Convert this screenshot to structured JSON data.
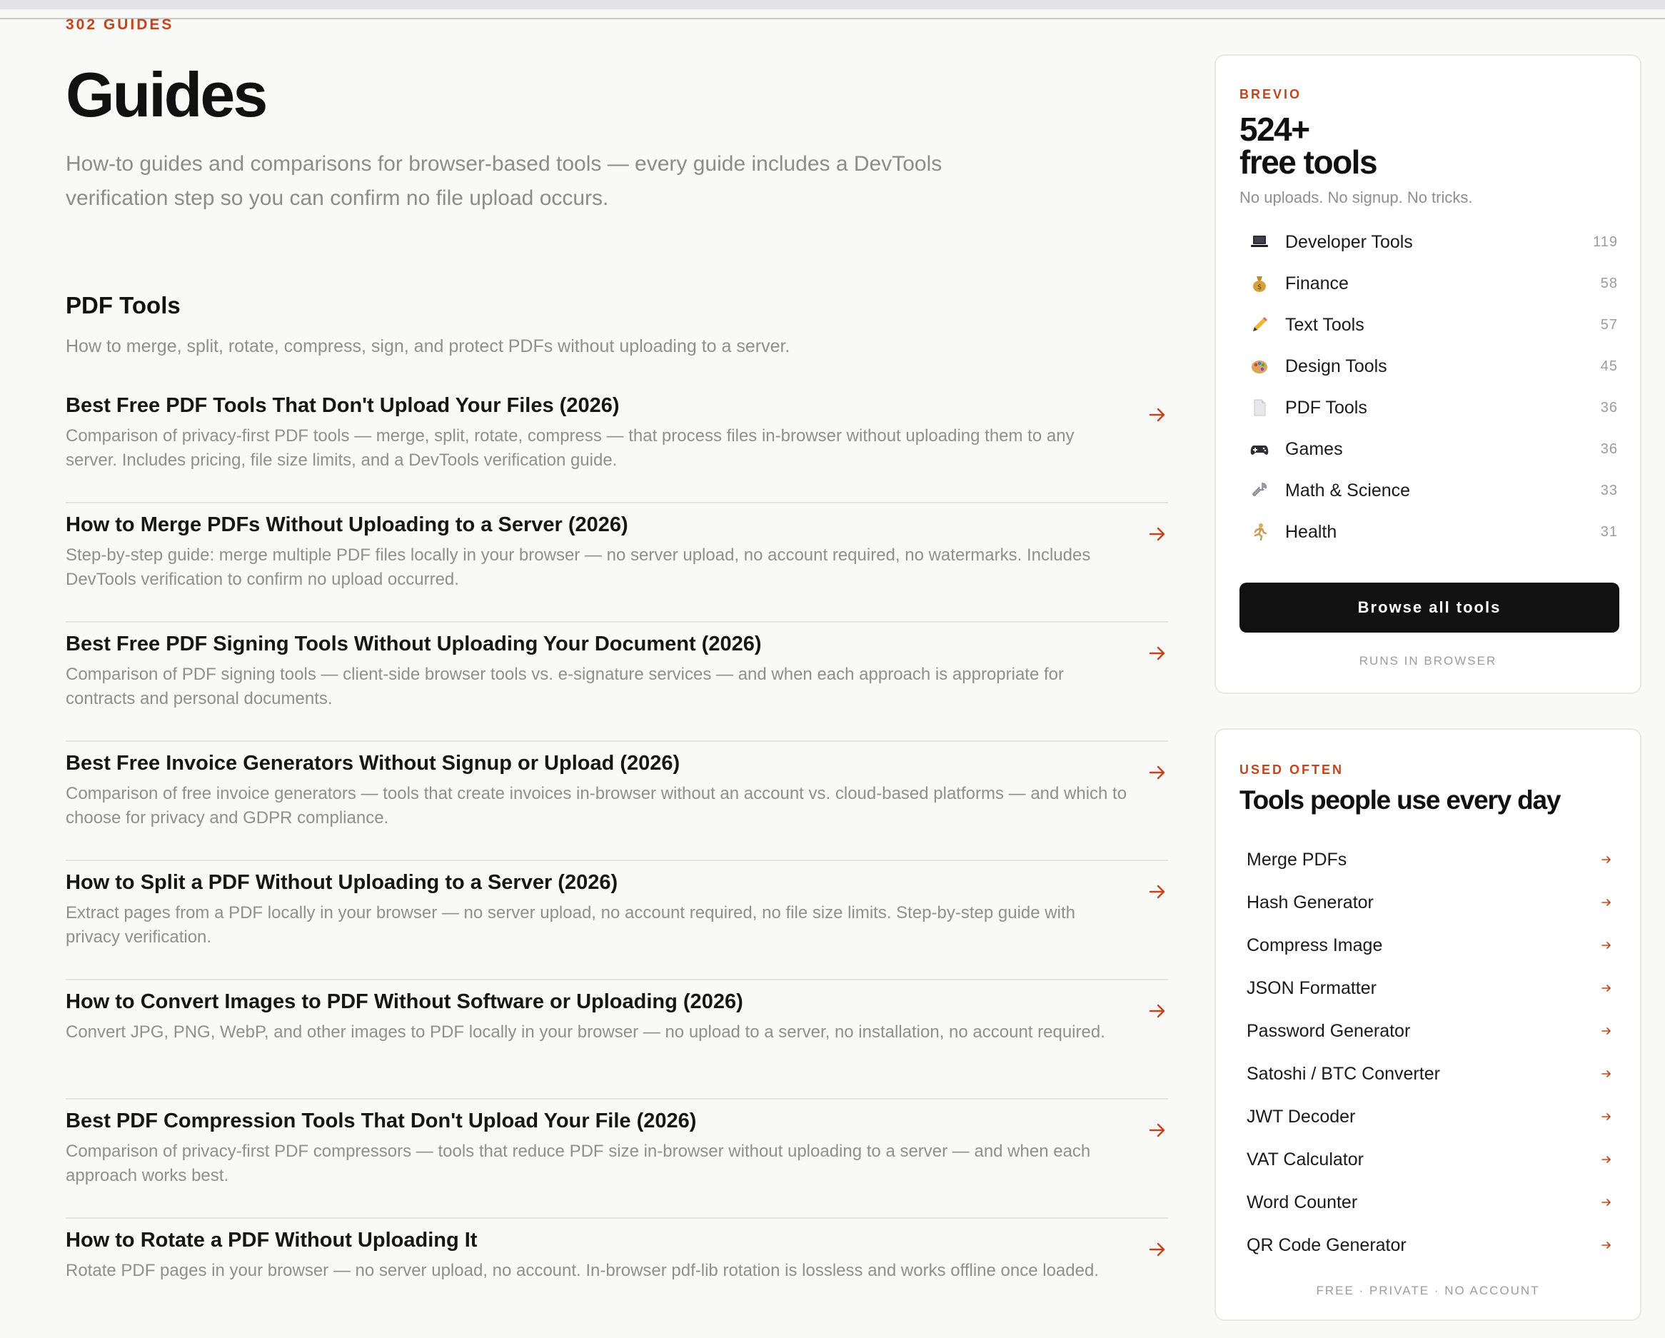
{
  "page": {
    "kicker": "302 GUIDES",
    "title": "Guides",
    "subtitle": "How-to guides and comparisons for browser-based tools — every guide includes a DevTools verification step so you can confirm no file upload occurs."
  },
  "section": {
    "title": "PDF Tools",
    "description": "How to merge, split, rotate, compress, sign, and protect PDFs without uploading to a server."
  },
  "guides": [
    {
      "title": "Best Free PDF Tools That Don't Upload Your Files (2026)",
      "description": "Comparison of privacy-first PDF tools — merge, split, rotate, compress — that process files in-browser without uploading them to any server. Includes pricing, file size limits, and a DevTools verification guide."
    },
    {
      "title": "How to Merge PDFs Without Uploading to a Server (2026)",
      "description": "Step-by-step guide: merge multiple PDF files locally in your browser — no server upload, no account required, no watermarks. Includes DevTools verification to confirm no upload occurred."
    },
    {
      "title": "Best Free PDF Signing Tools Without Uploading Your Document (2026)",
      "description": "Comparison of PDF signing tools — client-side browser tools vs. e-signature services — and when each approach is appropriate for contracts and personal documents."
    },
    {
      "title": "Best Free Invoice Generators Without Signup or Upload (2026)",
      "description": "Comparison of free invoice generators — tools that create invoices in-browser without an account vs. cloud-based platforms — and which to choose for privacy and GDPR compliance."
    },
    {
      "title": "How to Split a PDF Without Uploading to a Server (2026)",
      "description": "Extract pages from a PDF locally in your browser — no server upload, no account required, no file size limits. Step-by-step guide with privacy verification."
    },
    {
      "title": "How to Convert Images to PDF Without Software or Uploading (2026)",
      "description": "Convert JPG, PNG, WebP, and other images to PDF locally in your browser — no upload to a server, no installation, no account required."
    },
    {
      "title": "Best PDF Compression Tools That Don't Upload Your File (2026)",
      "description": "Comparison of privacy-first PDF compressors — tools that reduce PDF size in-browser without uploading to a server — and when each approach works best."
    },
    {
      "title": "How to Rotate a PDF Without Uploading It",
      "description": "Rotate PDF pages in your browser — no server upload, no account. In-browser pdf-lib rotation is lossless and works offline once loaded."
    }
  ],
  "brand_card": {
    "kicker": "BREVIO",
    "title_line1": "524+",
    "title_line2": "free tools",
    "subtitle": "No uploads. No signup. No tricks.",
    "categories": [
      {
        "label": "Developer Tools",
        "count": "119",
        "icon": "laptop-icon"
      },
      {
        "label": "Finance",
        "count": "58",
        "icon": "money-bag-icon"
      },
      {
        "label": "Text Tools",
        "count": "57",
        "icon": "pencil-icon"
      },
      {
        "label": "Design Tools",
        "count": "45",
        "icon": "palette-icon"
      },
      {
        "label": "PDF Tools",
        "count": "36",
        "icon": "document-icon"
      },
      {
        "label": "Games",
        "count": "36",
        "icon": "gamepad-icon"
      },
      {
        "label": "Math & Science",
        "count": "33",
        "icon": "wrench-icon"
      },
      {
        "label": "Health",
        "count": "31",
        "icon": "runner-icon"
      }
    ],
    "button_label": "Browse all tools",
    "footer": "RUNS IN BROWSER"
  },
  "used_card": {
    "kicker": "USED OFTEN",
    "title": "Tools people use every day",
    "tools": [
      "Merge PDFs",
      "Hash Generator",
      "Compress Image",
      "JSON Formatter",
      "Password Generator",
      "Satoshi / BTC Converter",
      "JWT Decoder",
      "VAT Calculator",
      "Word Counter",
      "QR Code Generator"
    ],
    "footer": "FREE · PRIVATE · NO ACCOUNT"
  },
  "colors": {
    "accent": "#c2441c",
    "button": "#111111",
    "background": "#f9f9f7"
  }
}
